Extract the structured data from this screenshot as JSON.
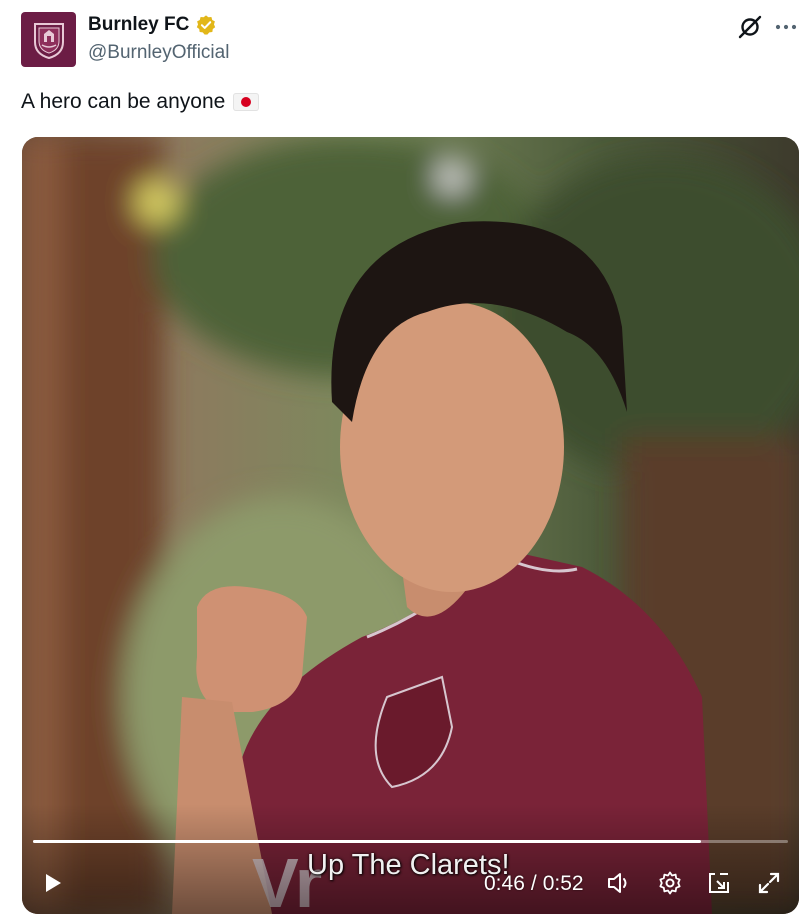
{
  "author": {
    "display_name": "Burnley FC",
    "handle": "@BurnleyOfficial",
    "verified_badge": "gold-checkmark-icon",
    "avatar": "burnley-crest-avatar"
  },
  "header_actions": [
    "grok-icon",
    "more-icon"
  ],
  "tweet": {
    "text": "A hero can be anyone",
    "emoji": "japan-flag-icon"
  },
  "video": {
    "caption": "Up The Clarets!",
    "current_time": "0:46",
    "separator": "/",
    "duration": "0:52",
    "progress_fraction": 0.885,
    "controls": [
      "play-icon",
      "volume-icon",
      "settings-icon",
      "dock-icon",
      "fullscreen-icon"
    ]
  },
  "colors": {
    "brand_claret": "#6c1d45",
    "verified_gold": "#e2b719",
    "text_primary": "#0f1419",
    "text_secondary": "#536471"
  }
}
